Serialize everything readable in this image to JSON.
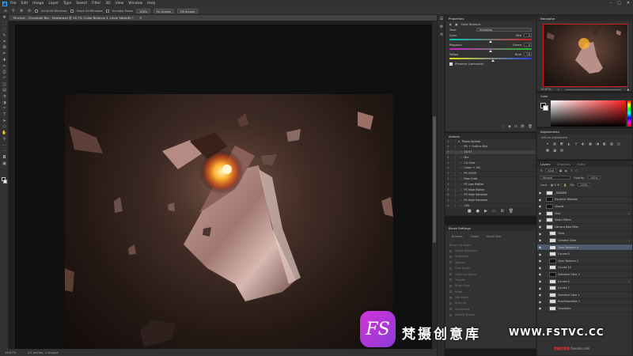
{
  "app": {
    "name": "Photoshop",
    "logo_text": "Ps"
  },
  "menubar": {
    "items": [
      "File",
      "Edit",
      "Image",
      "Layer",
      "Type",
      "Select",
      "Filter",
      "3D",
      "View",
      "Window",
      "Help"
    ],
    "window_controls": [
      "–",
      "▢",
      "✕"
    ]
  },
  "options_bar": {
    "scroll_all_windows": "Scroll All Windows",
    "zoom_level": "100%",
    "fit_screen": "Fit Screen",
    "fill_screen": "Fill Screen",
    "zoom_all_windows": "Zoom All Windows",
    "scrubby_zoom": "Scrubby Zoom"
  },
  "document": {
    "tab_title": "Pinchok - Chocolate Bar - Masterpsd @ 16.7% (Color Balance 4, Layer Mask/8) *",
    "status_zoom": "16.67%",
    "status_doc": "4.5 Inches, 4 Groups"
  },
  "properties_panel": {
    "title": "Properties",
    "header": "Color Balance",
    "tone_label": "Tone:",
    "tone_value": "Shadows",
    "sliders": [
      {
        "left": "Cyan",
        "right": "Red",
        "value": "0",
        "color": "linear-gradient(to right,#00c8c8,#e02020)",
        "pos": 0.5
      },
      {
        "left": "Magenta",
        "right": "Green",
        "value": "0",
        "color": "linear-gradient(to right,#d020d0,#20c020)",
        "pos": 0.5
      },
      {
        "left": "Yellow",
        "right": "Blue",
        "value": "+6",
        "color": "linear-gradient(to right,#e0e020,#2040e0)",
        "pos": 0.53
      }
    ],
    "preserve": "Preserve Luminosity"
  },
  "actions_panel": {
    "title": "Actions",
    "items": [
      "Photo Upload",
      "Pit + Outline Blur",
      "16.07",
      "Mix",
      "CA Shot",
      "Clean + OB",
      "PS CROR",
      "Raw Grab",
      "PS Low Matter",
      "PS High Matter",
      "PS High Saturate",
      "PS High Saturate",
      "100"
    ],
    "selected": 2
  },
  "brush_panel": {
    "title": "Brush Settings",
    "tabs": [
      "Brushes",
      "Shape",
      "Brush Size"
    ],
    "items": [
      "Brush Tip Shape",
      "Shape Dynamics",
      "Scattering",
      "Texture",
      "Dual Brush",
      "Color Dynamics",
      "Transfer",
      "Brush Pose",
      "Noise",
      "Wet Edges",
      "Build-up",
      "Smoothing",
      "Protect Texture"
    ]
  },
  "navigator_panel": {
    "title": "Navigator",
    "zoom": "16.67%"
  },
  "color_panel": {
    "title": "Color"
  },
  "adjustments_panel": {
    "title": "Adjustments",
    "subtitle": "Add an adjustment",
    "icons": [
      "☀",
      "▥",
      "◩",
      "◭",
      "▽",
      "◐",
      "▦",
      "◑",
      "◧",
      "▨",
      "◫",
      "▩",
      "◪",
      "▤"
    ]
  },
  "layers_panel": {
    "tabs": [
      "Layers",
      "Channels",
      "Paths"
    ],
    "kind": "Kind",
    "blend_mode": "Normal",
    "opacity_label": "Opacity:",
    "opacity": "100%",
    "lock_label": "Lock:",
    "fill_label": "Fill:",
    "fill": "100%",
    "layers": [
      {
        "name": "_RENDER",
        "dark": false,
        "sel": false
      },
      {
        "name": "Dynamic Material",
        "dark": true,
        "sel": false
      },
      {
        "name": "Shards",
        "dark": true,
        "sel": false
      },
      {
        "name": "Shot",
        "dark": false,
        "sel": false
      },
      {
        "name": "Smart Filters",
        "dark": false,
        "sel": false
      },
      {
        "name": "Camera Raw Filter",
        "dark": false,
        "sel": false
      },
      {
        "name": "Glow",
        "dark": false,
        "sel": false
      },
      {
        "name": "Caramel Color",
        "dark": false,
        "sel": false
      },
      {
        "name": "Color Balance 4",
        "dark": false,
        "sel": true
      },
      {
        "name": "Curves 8",
        "dark": false,
        "sel": false
      },
      {
        "name": "Color Balance 2",
        "dark": true,
        "sel": false
      },
      {
        "name": "Curves 10",
        "dark": false,
        "sel": false
      },
      {
        "name": "Selective Color 2",
        "dark": true,
        "sel": false
      },
      {
        "name": "Curves 8",
        "dark": false,
        "sel": false
      },
      {
        "name": "Curves 7",
        "dark": false,
        "sel": false
      },
      {
        "name": "Selective Color 1",
        "dark": false,
        "sel": false
      },
      {
        "name": "Hue/Saturation 1",
        "dark": false,
        "sel": false
      },
      {
        "name": "Chocolate",
        "dark": false,
        "sel": false
      }
    ]
  },
  "watermark": {
    "logo": "FS",
    "text": "梵摄创意库",
    "url": "WWW.FSTVC.CC",
    "tag_red": "梵摄创意库",
    "tag": "fsvedio.com"
  }
}
